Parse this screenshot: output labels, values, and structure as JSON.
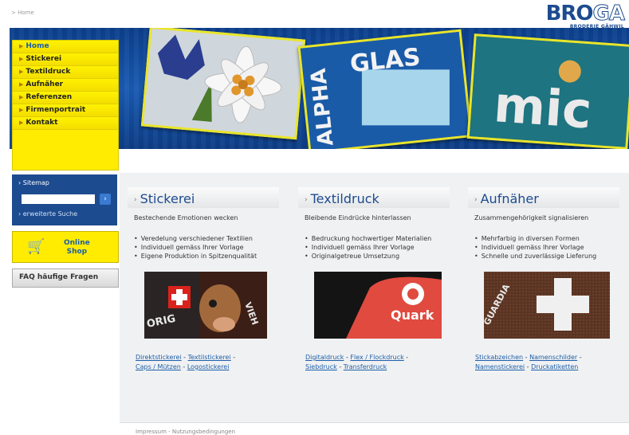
{
  "breadcrumb": "> Home",
  "logo": {
    "part1": "BRO",
    "part2": "GA",
    "subtitle": "BRODERIE GÄHWIL"
  },
  "hero": {
    "patch2_text": "ALPHAGLAS",
    "patch3_text": "mic"
  },
  "nav": {
    "items": [
      {
        "label": "Home"
      },
      {
        "label": "Stickerei"
      },
      {
        "label": "Textildruck"
      },
      {
        "label": "Aufnäher"
      },
      {
        "label": "Referenzen"
      },
      {
        "label": "Firmenportrait"
      },
      {
        "label": "Kontakt"
      }
    ]
  },
  "search": {
    "label": "Sitemap",
    "value": "",
    "go": "›",
    "advanced": "erweiterte Suche"
  },
  "shop": {
    "label_line1": "Online",
    "label_line2": "Shop"
  },
  "faq": {
    "label": "FAQ häufige Fragen"
  },
  "columns": [
    {
      "title": "Stickerei",
      "subtitle": "Bestechende Emotionen wecken",
      "bullets": [
        "Veredelung verschiedener Textilien",
        "Individuell gemäss Ihrer Vorlage",
        "Eigene Produktion in Spitzenqualität"
      ],
      "image_text": [
        "ORIG",
        "VIEH"
      ],
      "links": [
        "Direktstickerei",
        "Textilstickerei",
        "Caps / Mützen",
        "Logostickerei"
      ]
    },
    {
      "title": "Textildruck",
      "subtitle": "Bleibende Eindrücke hinterlassen",
      "bullets": [
        "Bedruckung hochwertiger Materialien",
        "Individuell gemäss Ihrer Vorlage",
        "Originalgetreue Umsetzung"
      ],
      "image_text": [
        "Quark"
      ],
      "links": [
        "Digitaldruck",
        "Flex / Flockdruck",
        "Siebdruck",
        "Transferdruck"
      ]
    },
    {
      "title": "Aufnäher",
      "subtitle": "Zusammengehörigkeit signalisieren",
      "bullets": [
        "Mehrfarbig in diversen Formen",
        "Individuell gemäss Ihrer Vorlage",
        "Schnelle und zuverlässige Lieferung"
      ],
      "image_text": [
        "GUARDIA"
      ],
      "links": [
        "Stickabzeichen",
        "Namenschilder",
        "Namenstickerei",
        "Druckatiketten"
      ]
    }
  ],
  "footer": "Impressum - Nutzungsbedingungen",
  "colors": {
    "brand_blue": "#1d4b8f",
    "nav_yellow": "#ffec00",
    "link_blue": "#1d5fa8"
  }
}
